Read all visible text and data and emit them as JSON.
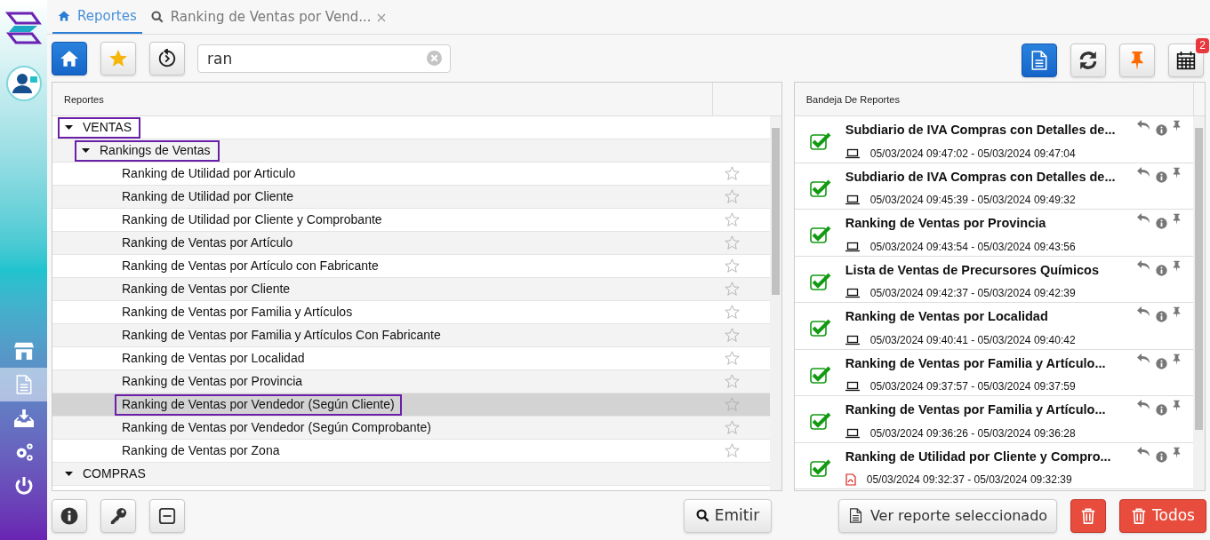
{
  "tabs": [
    {
      "label": "Reportes",
      "selected": true,
      "closable": false
    },
    {
      "label": "Ranking de Ventas por Vend...",
      "selected": false,
      "closable": true
    }
  ],
  "sidebar": {
    "items": [
      {
        "selected": false
      },
      {
        "selected": true
      },
      {
        "selected": false
      },
      {
        "selected": false
      },
      {
        "selected": false
      }
    ]
  },
  "toolbar": {
    "left_buttons": [
      {
        "selected": true
      },
      {
        "selected": false
      },
      {
        "selected": false
      }
    ],
    "search": {
      "value": "ran"
    },
    "right_buttons": [
      {
        "selected": true
      },
      {
        "selected": false
      },
      {
        "selected": false
      },
      {
        "selected": false,
        "badge": "2"
      }
    ]
  },
  "reports_panel": {
    "header": "Reportes",
    "tree": [
      {
        "label": "VENTAS",
        "expanded": true,
        "outlined": true,
        "children": [
          {
            "label": "Rankings de Ventas",
            "expanded": true,
            "outlined": true,
            "children": [
              {
                "label": "Ranking de Utilidad por Articulo",
                "selected": false,
                "outlined": false,
                "favorite": false
              },
              {
                "label": "Ranking de Utilidad por Cliente",
                "selected": false,
                "outlined": false,
                "favorite": false
              },
              {
                "label": "Ranking de Utilidad por Cliente y Comprobante",
                "selected": false,
                "outlined": false,
                "favorite": false
              },
              {
                "label": "Ranking de Ventas por Artículo",
                "selected": false,
                "outlined": false,
                "favorite": false
              },
              {
                "label": "Ranking de Ventas por Artículo con Fabricante",
                "selected": false,
                "outlined": false,
                "favorite": false
              },
              {
                "label": "Ranking de Ventas por Cliente",
                "selected": false,
                "outlined": false,
                "favorite": false
              },
              {
                "label": "Ranking de Ventas por Familia y Artículos",
                "selected": false,
                "outlined": false,
                "favorite": false
              },
              {
                "label": "Ranking de Ventas por Familia y Artículos Con Fabricante",
                "selected": false,
                "outlined": false,
                "favorite": false
              },
              {
                "label": "Ranking de Ventas por Localidad",
                "selected": false,
                "outlined": false,
                "favorite": false
              },
              {
                "label": "Ranking de Ventas por Provincia",
                "selected": false,
                "outlined": false,
                "favorite": false
              },
              {
                "label": "Ranking de Ventas por Vendedor (Según Cliente)",
                "selected": true,
                "outlined": true,
                "favorite": false
              },
              {
                "label": "Ranking de Ventas por Vendedor (Según Comprobante)",
                "selected": false,
                "outlined": false,
                "favorite": false
              },
              {
                "label": "Ranking de Ventas por Zona",
                "selected": false,
                "outlined": false,
                "favorite": false
              }
            ]
          }
        ]
      },
      {
        "label": "COMPRAS",
        "expanded": true,
        "outlined": false
      }
    ]
  },
  "inbox_panel": {
    "header": "Bandeja De Reportes",
    "items": [
      {
        "title": "Subdiario de IVA Compras con Detalles de...",
        "kind": "screen",
        "checked": true,
        "time": "05/03/2024 09:47:02 - 05/03/2024 09:47:04"
      },
      {
        "title": "Subdiario de IVA Compras con Detalles de...",
        "kind": "screen",
        "checked": true,
        "time": "05/03/2024 09:45:39 - 05/03/2024 09:49:32"
      },
      {
        "title": "Ranking de Ventas por Provincia",
        "kind": "screen",
        "checked": true,
        "time": "05/03/2024 09:43:54 - 05/03/2024 09:43:56"
      },
      {
        "title": "Lista de Ventas de Precursores Químicos",
        "kind": "screen",
        "checked": true,
        "time": "05/03/2024 09:42:37 - 05/03/2024 09:42:39"
      },
      {
        "title": "Ranking de Ventas por Localidad",
        "kind": "screen",
        "checked": true,
        "time": "05/03/2024 09:40:41 - 05/03/2024 09:40:42"
      },
      {
        "title": "Ranking de Ventas por Familia y Artículo...",
        "kind": "screen",
        "checked": true,
        "time": "05/03/2024 09:37:57 - 05/03/2024 09:37:59"
      },
      {
        "title": "Ranking de Ventas por Familia y Artículo...",
        "kind": "screen",
        "checked": true,
        "time": "05/03/2024 09:36:26 - 05/03/2024 09:36:28"
      },
      {
        "title": "Ranking de Utilidad por Cliente y Compro...",
        "kind": "pdf",
        "checked": true,
        "time": "05/03/2024 09:32:37 - 05/03/2024 09:32:39"
      }
    ]
  },
  "emitir_button": {
    "label": "Emitir"
  },
  "view_button": {
    "label": "Ver reporte seleccionado"
  },
  "delete_all_button": {
    "label": "Todos"
  }
}
